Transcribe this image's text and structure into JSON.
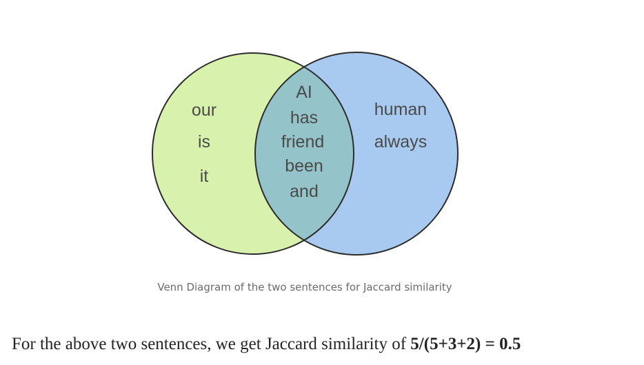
{
  "venn": {
    "left_only": [
      "our",
      "is",
      "it"
    ],
    "intersection": [
      "AI",
      "has",
      "friend",
      "been",
      "and"
    ],
    "right_only": [
      "human",
      "always"
    ],
    "colors": {
      "left_fill": "#d8f1ad",
      "right_fill": "#a9caf0",
      "overlap_fill": "#94c3c9",
      "stroke": "#2b2b2b"
    }
  },
  "caption": "Venn Diagram of the two sentences for Jaccard similarity",
  "sentence": {
    "text": "For the above two sentences, we get Jaccard similarity of ",
    "formula": "5/(5+3+2) = 0.5"
  }
}
